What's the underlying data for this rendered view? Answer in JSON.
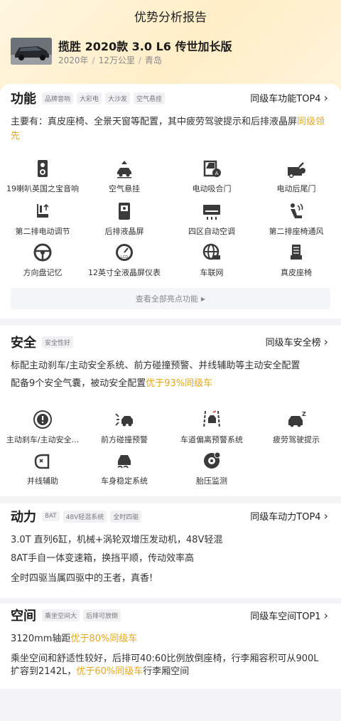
{
  "header": {
    "title": "优势分析报告",
    "car_name": "揽胜 2020款 3.0 L6 传世加长版",
    "year": "2020年",
    "mileage": "12万公里",
    "city": "青岛",
    "separator": "/"
  },
  "function": {
    "title": "功能",
    "tags": [
      "品牌音响",
      "大彩电",
      "大沙发",
      "空气悬挂"
    ],
    "rank": "同级车功能TOP4",
    "desc_prefix": "主要有：真皮座椅、全景天窗等配置，其中疲劳驾驶提示和后排液晶屏",
    "desc_highlight": "同级领先",
    "features": [
      {
        "label": "19喇叭英国之宝音响",
        "icon": "speaker-icon"
      },
      {
        "label": "空气悬挂",
        "icon": "air-suspension-icon"
      },
      {
        "label": "电动吸合门",
        "icon": "power-door-icon"
      },
      {
        "label": "电动后尾门",
        "icon": "power-tailgate-icon"
      },
      {
        "label": "第二排电动调节",
        "icon": "power-seat-icon"
      },
      {
        "label": "后排液晶屏",
        "icon": "rear-screen-icon"
      },
      {
        "label": "四区自动空调",
        "icon": "climate-control-icon"
      },
      {
        "label": "第二排座椅通风",
        "icon": "seat-ventilation-icon"
      },
      {
        "label": "方向盘记忆",
        "icon": "steering-wheel-icon"
      },
      {
        "label": "12英寸全液晶屏仪表",
        "icon": "lcd-dashboard-icon"
      },
      {
        "label": "车联网",
        "icon": "connected-car-icon"
      },
      {
        "label": "真皮座椅",
        "icon": "leather-seat-icon"
      }
    ],
    "view_all": "查看全部亮点功能"
  },
  "safety": {
    "title": "安全",
    "tags": [
      "安全性好"
    ],
    "rank": "同级车安全榜",
    "line1": "标配主动刹车/主动安全系统、前方碰撞预警、并线辅助等主动安全配置",
    "line2_prefix": "配备9个安全气囊，被动安全配置",
    "line2_highlight": "优于93%同级车",
    "features": [
      {
        "label": "主动刹车/主动安全...",
        "icon": "active-brake-icon"
      },
      {
        "label": "前方碰撞预警",
        "icon": "collision-warning-icon"
      },
      {
        "label": "车道偏离预警系统",
        "icon": "lane-departure-icon"
      },
      {
        "label": "疲劳驾驶提示",
        "icon": "fatigue-warning-icon"
      },
      {
        "label": "并线辅助",
        "icon": "lane-change-assist-icon"
      },
      {
        "label": "车身稳定系统",
        "icon": "stability-control-icon"
      },
      {
        "label": "胎压监测",
        "icon": "tire-pressure-icon"
      }
    ]
  },
  "power": {
    "title": "动力",
    "tags": [
      "8AT",
      "48V轻混系统",
      "全时四驱"
    ],
    "rank": "同级车动力TOP4",
    "lines": [
      "3.0T 直列6缸，机械+涡轮双增压发动机，48V轻混",
      "8AT手自一体变速箱，换挡平顺，传动效率高",
      "全时四驱当属四驱中的王者，真香!"
    ]
  },
  "space": {
    "title": "空间",
    "tags": [
      "乘坐空间大",
      "后排可放倒"
    ],
    "rank": "同级车空间TOP1",
    "wheelbase_prefix": "3120mm轴距",
    "wheelbase_highlight": "优于80%同级车",
    "line2": "乘坐空间和舒适性较好，后排可40:60比例放倒座椅，行李厢容积可从900L",
    "line3_prefix": "扩容到2142L，",
    "line3_highlight": "优于60%同级车",
    "line3_suffix": "行李厢空间"
  },
  "colors": {
    "highlight": "#e6a817",
    "hero_gradient": "#ffeec7",
    "page_bg": "#f4f4f6"
  }
}
